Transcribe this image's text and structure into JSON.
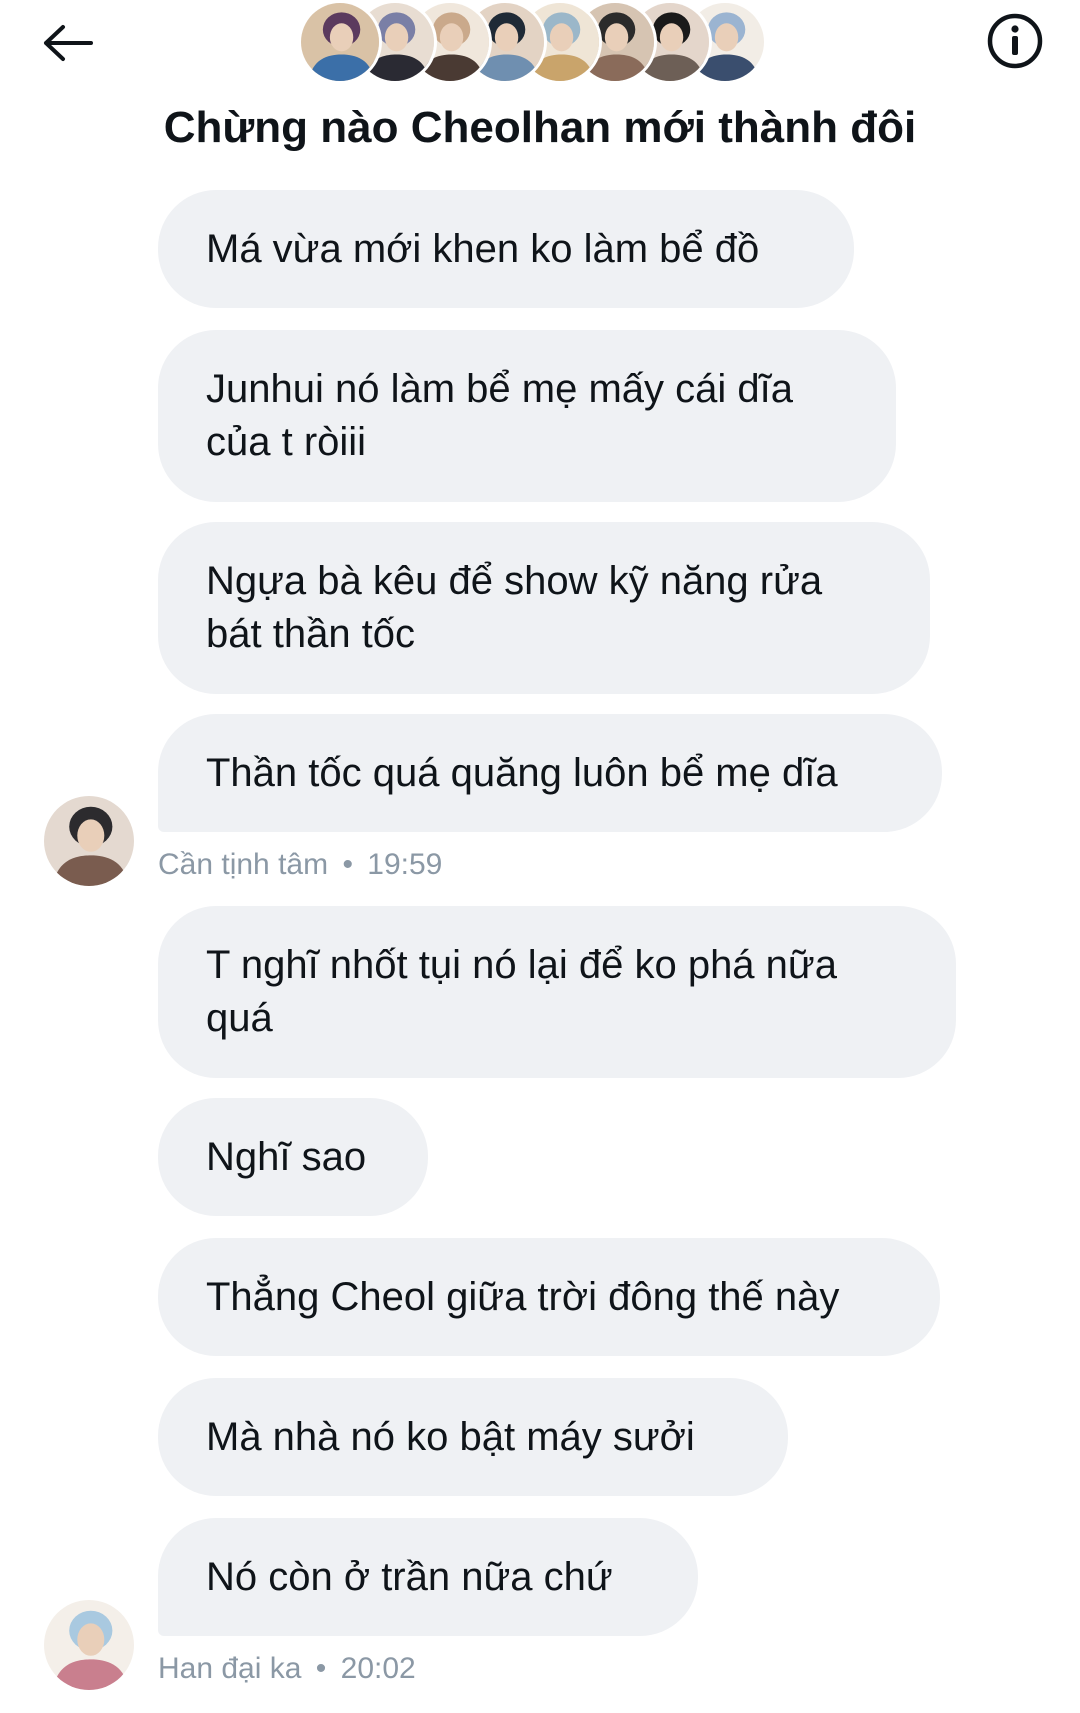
{
  "header": {
    "back_icon": "arrow-left-icon",
    "info_icon": "info-circle-icon",
    "title": "Chừng nào Cheolhan mới thành đôi",
    "member_avatars": [
      {
        "colors": [
          "#5b3a5e",
          "#d9c2a6",
          "#3b6fa8"
        ]
      },
      {
        "colors": [
          "#7a7fa6",
          "#e8ddd2",
          "#2a2a33"
        ]
      },
      {
        "colors": [
          "#caa98b",
          "#f0e7dc",
          "#4a3a33"
        ]
      },
      {
        "colors": [
          "#1f2a36",
          "#e3d3c4",
          "#6f8fb0"
        ]
      },
      {
        "colors": [
          "#9bb7c9",
          "#efe5d6",
          "#c9a46b"
        ]
      },
      {
        "colors": [
          "#2b2b2b",
          "#d6c4b2",
          "#8a6b5a"
        ]
      },
      {
        "colors": [
          "#1a1a1a",
          "#e4d6cb",
          "#6d5f56"
        ]
      },
      {
        "colors": [
          "#9bb4d1",
          "#f2ede6",
          "#3a4e6e"
        ]
      }
    ]
  },
  "messages": [
    {
      "sender": "Cần tịnh tâm",
      "time": "19:59",
      "meta_separator": "•",
      "avatar_colors": [
        "#2c2b2e",
        "#e4d9d0",
        "#7a5c4f"
      ],
      "bubbles": [
        {
          "text": "Má vừa mới khen ko làm bể đồ"
        },
        {
          "text": "Junhui nó làm bể mẹ mấy cái dĩa của t ròiii"
        },
        {
          "text": "Ngựa bà kêu để show kỹ năng rửa bát thần tốc"
        },
        {
          "text": "Thần tốc quá quăng luôn bể mẹ dĩa"
        }
      ]
    },
    {
      "sender": "Han đại ka",
      "time": "20:02",
      "meta_separator": "•",
      "avatar_colors": [
        "#a9c9e0",
        "#f4efe9",
        "#c97f8e"
      ],
      "bubbles": [
        {
          "text": "T nghĩ nhốt tụi nó lại để ko phá nữa quá"
        },
        {
          "text": "Nghĩ sao"
        },
        {
          "text": "Thẳng Cheol giữa trời đông thế này"
        },
        {
          "text": "Mà nhà nó ko bật máy sưởi"
        },
        {
          "text": "Nó còn ở trần nữa chứ"
        }
      ]
    }
  ],
  "colors": {
    "bubble_bg": "#eff1f4",
    "meta_text": "#8b98a5",
    "primary_text": "#0f1419"
  }
}
